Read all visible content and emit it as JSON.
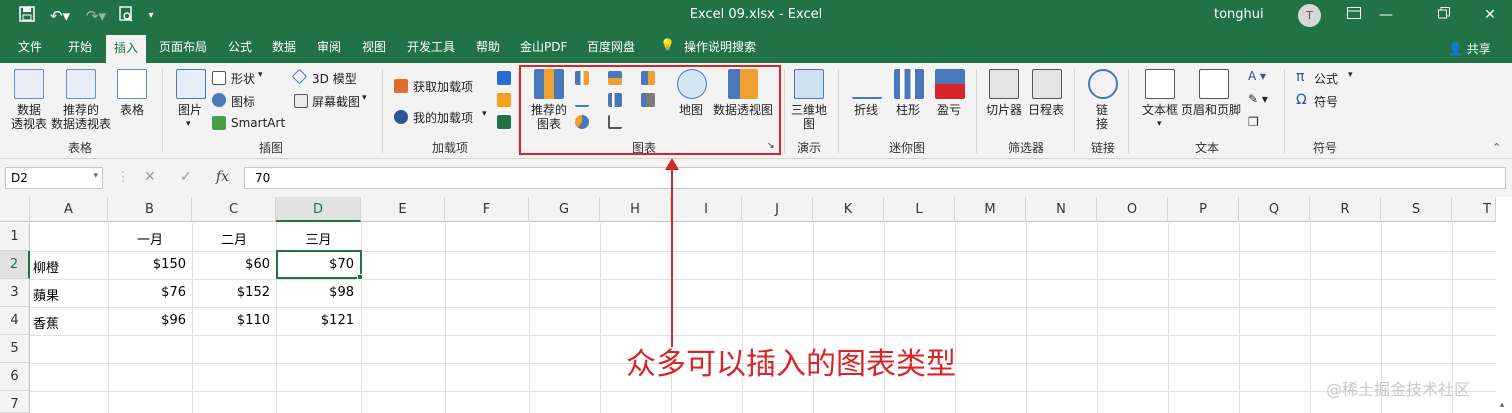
{
  "title_bar": {
    "document_title": "Excel 09.xlsx  -  Excel",
    "user_name": "tonghui",
    "avatar_letter": "T",
    "icons": {
      "save": "save-icon",
      "undo": "undo-icon",
      "redo": "redo-icon",
      "print_preview": "print-preview-icon",
      "customize": "customize-quick-access-icon"
    },
    "window_buttons": [
      "ribbon-display-icon",
      "restore-icon",
      "close-icon"
    ]
  },
  "menu": {
    "tabs": [
      "文件",
      "开始",
      "插入",
      "页面布局",
      "公式",
      "数据",
      "审阅",
      "视图",
      "开发工具",
      "帮助",
      "金山PDF",
      "百度网盘",
      "操作说明搜索"
    ],
    "active_tab": "插入",
    "share_label": "共享"
  },
  "ribbon": {
    "tables": {
      "group": "表格",
      "pivot": "数据\n透视表",
      "recommended_pivot": "推荐的\n数据透视表",
      "table": "表格"
    },
    "illustrations": {
      "group": "插图",
      "pictures": "图片",
      "shapes": "形状",
      "icons": "图标",
      "smartart": "SmartArt",
      "model3d": "3D 模型",
      "screenshot": "屏幕截图"
    },
    "addins": {
      "group": "加载项",
      "get": "获取加载项",
      "my": "我的加载项"
    },
    "charts": {
      "group": "图表",
      "recommended": "推荐的\n图表",
      "map": "地图",
      "pivot_chart": "数据透视图"
    },
    "tours": {
      "group": "演示",
      "map3d": "三维地\n图"
    },
    "sparklines": {
      "group": "迷你图",
      "line": "折线",
      "column": "柱形",
      "winloss": "盈亏"
    },
    "filters": {
      "group": "筛选器",
      "slicer": "切片器",
      "timeline": "日程表"
    },
    "links": {
      "group": "链接",
      "link": "链\n接"
    },
    "text": {
      "group": "文本",
      "textbox": "文本框",
      "header_footer": "页眉和页脚"
    },
    "symbols": {
      "group": "符号",
      "equation": "公式",
      "symbol": "符号"
    }
  },
  "formula_bar": {
    "name_box": "D2",
    "cancel_icon": "cancel-icon",
    "enter_icon": "enter-icon",
    "fx": "fx",
    "value": "70"
  },
  "sheet": {
    "columns": [
      "A",
      "B",
      "C",
      "D",
      "E",
      "F",
      "G",
      "H",
      "I",
      "J",
      "K",
      "L",
      "M",
      "N",
      "O",
      "P",
      "Q",
      "R",
      "S",
      "T"
    ],
    "rows": [
      "1",
      "2",
      "3",
      "4",
      "5",
      "6",
      "7"
    ],
    "selected_cell": "D2",
    "cells": {
      "B1": "一月",
      "C1": "二月",
      "D1": "三月",
      "A2": "柳橙",
      "B2": "$150",
      "C2": "$60",
      "D2": "$70",
      "A3": "蘋果",
      "B3": "$76",
      "C3": "$152",
      "D3": "$98",
      "A4": "香蕉",
      "B4": "$96",
      "C4": "$110",
      "D4": "$121"
    }
  },
  "annotation": {
    "text": "众多可以插入的图表类型",
    "color": "#d8252c"
  },
  "watermark": "@稀土掘金技术社区",
  "colors": {
    "excel_green": "#217346",
    "ribbon_bg": "#f3f3f3",
    "highlight_red": "#d8252c"
  }
}
